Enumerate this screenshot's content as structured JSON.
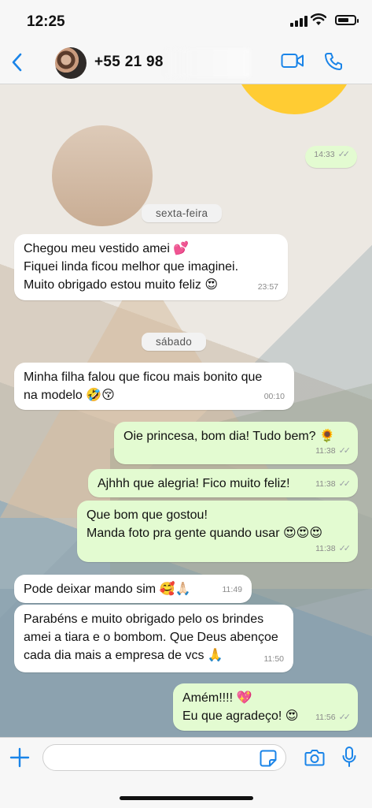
{
  "status_bar": {
    "time": "12:25",
    "battery_level": 0.7
  },
  "header": {
    "contact_name": "+55 21 98",
    "avatar_icon": "contact-photo",
    "back_icon": "chevron-left-icon",
    "video_icon": "video-camera-icon",
    "call_icon": "phone-icon"
  },
  "messages": [
    {
      "side": "out",
      "text": "",
      "time": "14:33",
      "read_ticks": "✓✓"
    },
    {
      "side": "day",
      "text": "sexta-feira"
    },
    {
      "side": "in",
      "text": "Chegou meu vestido amei 💕\nFiquei linda ficou melhor que imaginei.\nMuito obrigado estou muito feliz 😍",
      "time": "23:57"
    },
    {
      "side": "day",
      "text": "sábado"
    },
    {
      "side": "in",
      "text": "Minha filha falou que ficou mais bonito que\nna modelo 🤣😚",
      "time": "00:10"
    },
    {
      "side": "out",
      "text": "Oie princesa, bom dia! Tudo bem? 🌻",
      "time": "11:38",
      "read_ticks": "✓✓"
    },
    {
      "side": "out",
      "text": "Ajhhh que alegria! Fico muito feliz!",
      "time": "11:38",
      "read_ticks": "✓✓"
    },
    {
      "side": "out",
      "text": "Que bom que gostou!\nManda foto pra gente quando usar 😍😍😍",
      "time": "11:38",
      "read_ticks": "✓✓"
    },
    {
      "side": "in",
      "text": "Pode deixar mando sim 🥰🙏🏻",
      "time": "11:49"
    },
    {
      "side": "in",
      "text": "Parabéns e muito obrigado pelo os brindes\namei a tiara e o bombom. Que Deus abençoe\ncada dia mais a empresa de vcs 🙏",
      "time": "11:50"
    },
    {
      "side": "out",
      "text": "Amém!!!! 💖\nEu que agradeço! 😍",
      "time": "11:56",
      "read_ticks": "✓✓"
    }
  ],
  "composer": {
    "placeholder": "",
    "plus_icon": "plus-icon",
    "sticker_icon": "sticker-icon",
    "camera_icon": "camera-icon",
    "mic_icon": "microphone-icon"
  },
  "colors": {
    "accent": "#1a84e8",
    "outgoing": "#e3fbd1",
    "incoming": "#ffffff"
  }
}
